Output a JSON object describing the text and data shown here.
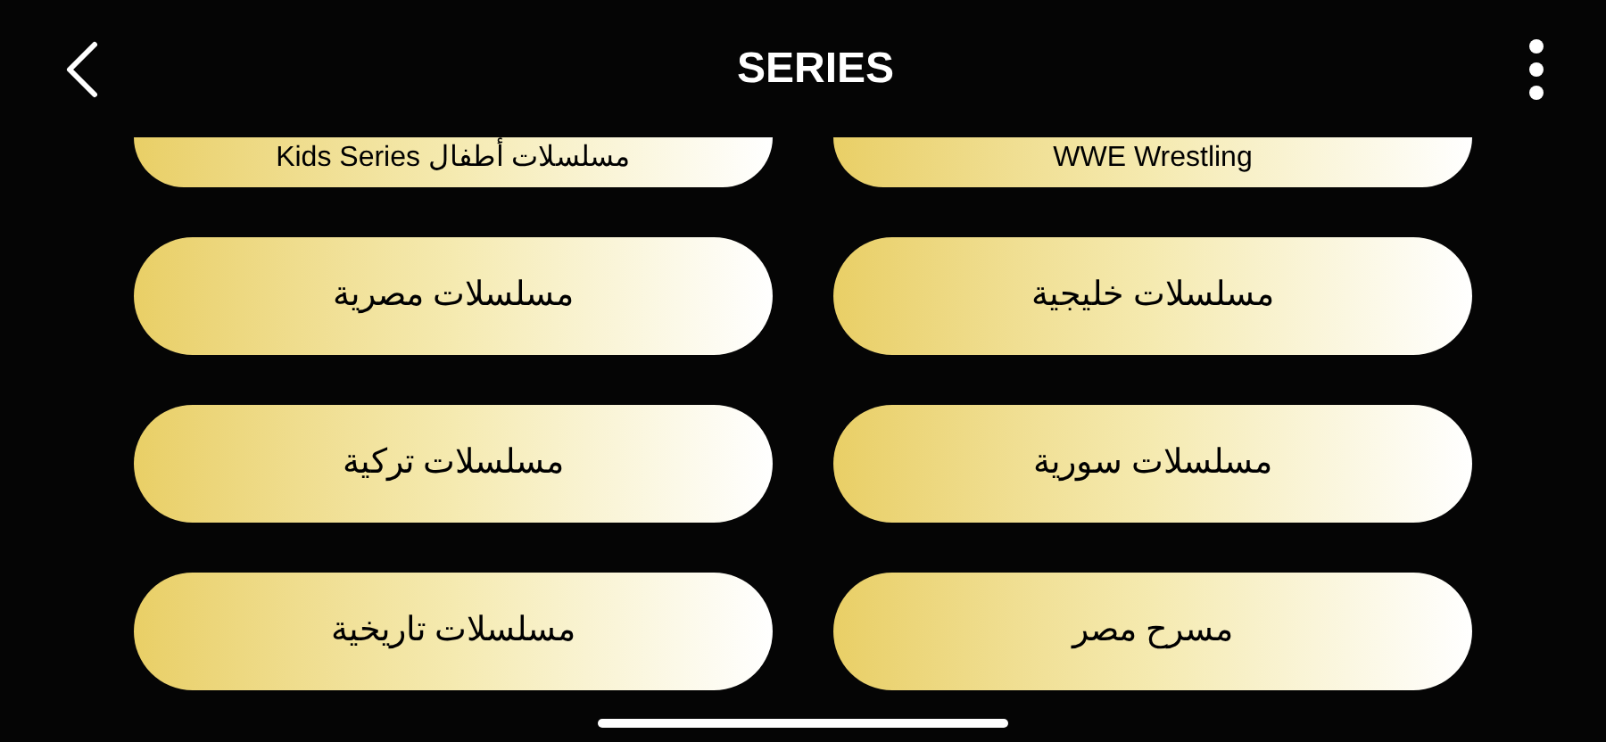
{
  "header": {
    "title": "SERIES"
  },
  "categories": [
    {
      "label": "WWE Wrestling"
    },
    {
      "label": "Kids Series مسلسلات أطفال"
    },
    {
      "label": "مسلسلات خليجية"
    },
    {
      "label": "مسلسلات مصرية"
    },
    {
      "label": "مسلسلات سورية"
    },
    {
      "label": "مسلسلات تركية"
    },
    {
      "label": "مسرح مصر"
    },
    {
      "label": "مسلسلات تاريخية"
    }
  ]
}
